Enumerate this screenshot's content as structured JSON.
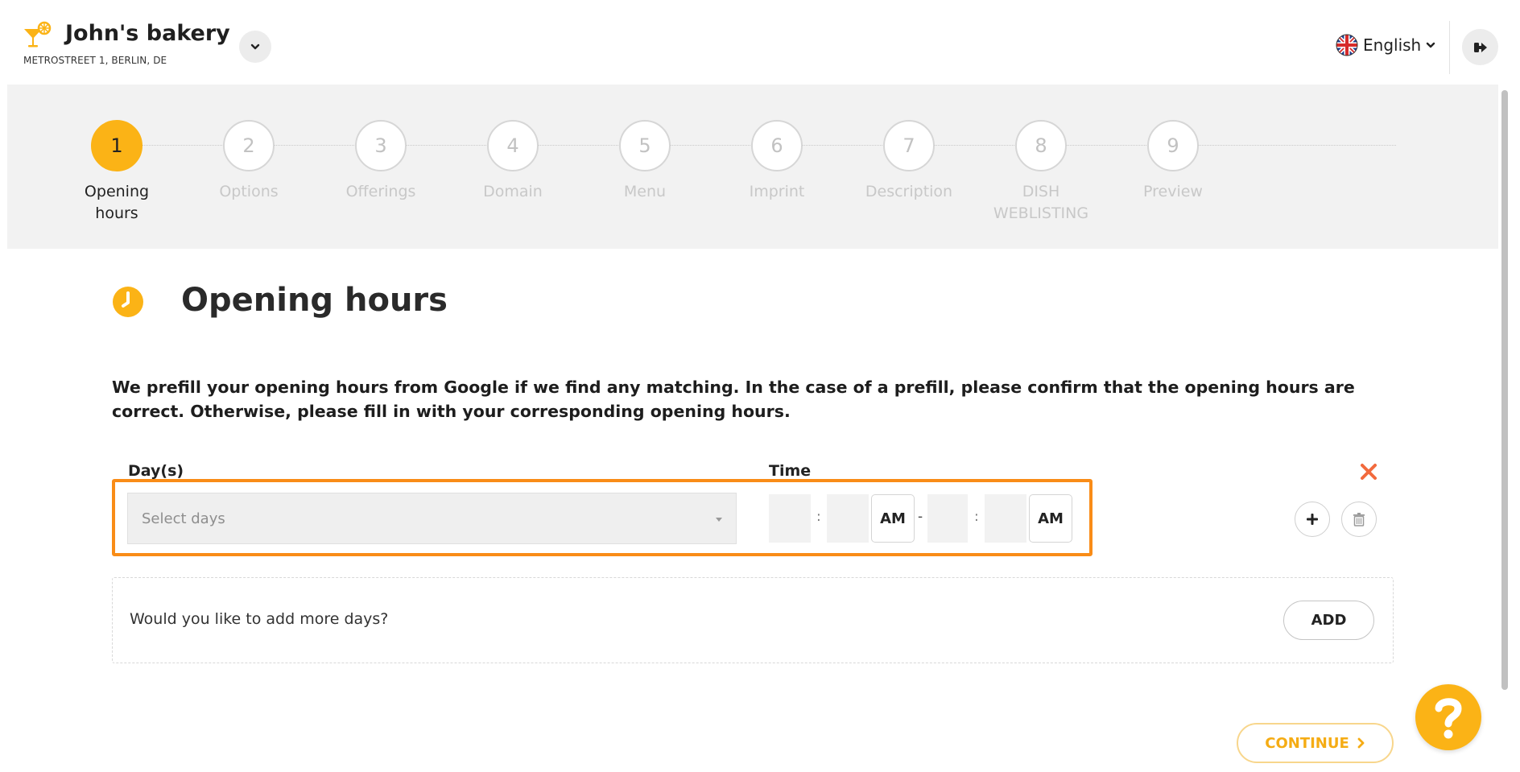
{
  "header": {
    "business_name": "John's bakery",
    "business_address": "METROSTREET 1, BERLIN, DE",
    "language": "English"
  },
  "stepper": {
    "steps": [
      {
        "number": "1",
        "label": "Opening hours",
        "active": true
      },
      {
        "number": "2",
        "label": "Options",
        "active": false
      },
      {
        "number": "3",
        "label": "Offerings",
        "active": false
      },
      {
        "number": "4",
        "label": "Domain",
        "active": false
      },
      {
        "number": "5",
        "label": "Menu",
        "active": false
      },
      {
        "number": "6",
        "label": "Imprint",
        "active": false
      },
      {
        "number": "7",
        "label": "Description",
        "active": false
      },
      {
        "number": "8",
        "label": "DISH WEBLISTING",
        "active": false
      },
      {
        "number": "9",
        "label": "Preview",
        "active": false
      }
    ]
  },
  "main": {
    "title": "Opening hours",
    "intro": "We prefill your opening hours from Google if we find any matching. In the case of a prefill, please confirm that the opening hours are correct. Otherwise, please fill in with your corresponding opening hours.",
    "days_label": "Day(s)",
    "time_label": "Time",
    "days_placeholder": "Select days",
    "time_from": {
      "hour": "",
      "minute": "",
      "period": "AM"
    },
    "time_to": {
      "hour": "",
      "minute": "",
      "period": "AM"
    },
    "colon": ":",
    "dash": "-",
    "more_days_text": "Would you like to add more days?",
    "add_label": "ADD",
    "continue_label": "CONTINUE"
  },
  "colors": {
    "accent": "#fbb316",
    "highlight": "#f98c17",
    "delete": "#f26a3d"
  }
}
